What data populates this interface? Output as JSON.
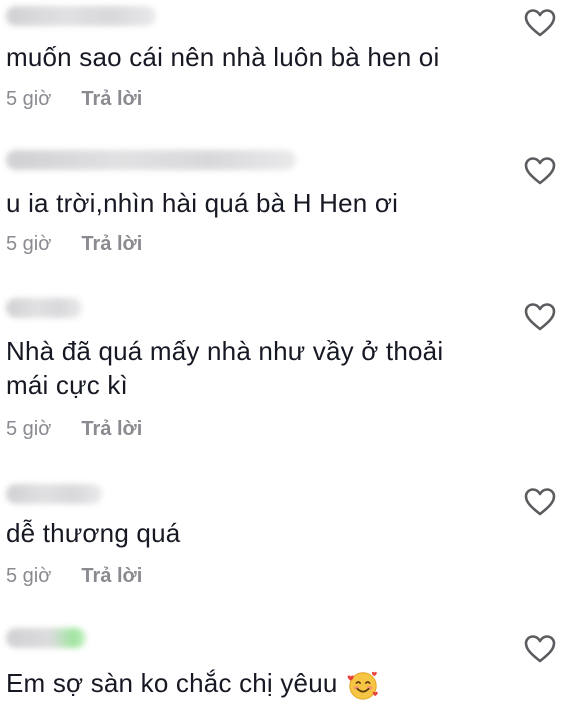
{
  "comments": [
    {
      "text": "muốn sao cái nên nhà luôn bà hen oi",
      "time": "5 giờ",
      "reply": "Trả lời",
      "like_icon": "heart-outline-icon"
    },
    {
      "text": "u ia trời,nhìn hài quá bà H Hen ơi",
      "time": "5 giờ",
      "reply": "Trả lời",
      "like_icon": "heart-outline-icon"
    },
    {
      "text": "Nhà đã quá mấy nhà như vầy ở thoải mái cực kì",
      "time": "5 giờ",
      "reply": "Trả lời",
      "like_icon": "heart-outline-icon"
    },
    {
      "text": "dễ thương quá",
      "time": "5 giờ",
      "reply": "Trả lời",
      "like_icon": "heart-outline-icon"
    },
    {
      "text": "Em sợ sàn ko chắc chị yêuu",
      "emoji": "smiling-face-with-hearts",
      "like_icon": "heart-outline-icon"
    }
  ],
  "colors": {
    "text": "#161823",
    "meta": "#8a8b91",
    "icon": "#5c5c60"
  }
}
